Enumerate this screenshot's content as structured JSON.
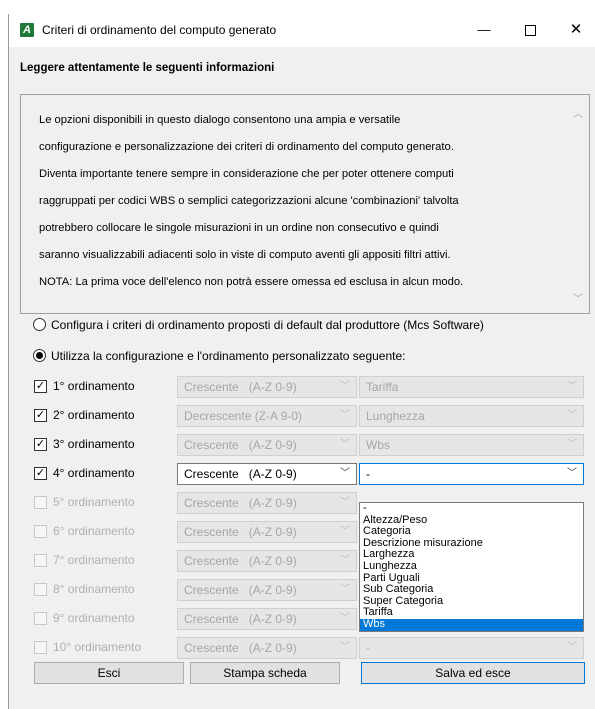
{
  "window": {
    "title": "Criteri di ordinamento del computo generato",
    "icon_letter": "A",
    "minimize": "—",
    "close": "✕"
  },
  "info": {
    "heading": "Leggere attentamente le seguenti informazioni",
    "lines": [
      "Le opzioni disponibili in questo dialogo consentono una ampia e versatile",
      "configurazione e personalizzazione dei criteri di ordinamento del computo generato.",
      "Diventa importante tenere sempre in considerazione che per poter ottenere computi",
      "raggruppati per codici WBS o semplici categorizzazioni alcune 'combinazioni' talvolta",
      "potrebbero collocare le singole misurazioni in un ordine non consecutivo e quindi",
      "saranno visualizzabili adiacenti solo in viste di computo aventi gli appositi filtri attivi.",
      "NOTA: La prima voce dell'elenco non potrà essere omessa ed esclusa in alcun modo."
    ]
  },
  "options": {
    "default_label": "Configura i criteri di ordinamento proposti di default dal produttore (Mcs Software)",
    "custom_label": "Utilizza la configurazione e l'ordinamento personalizzato seguente:",
    "selected": "custom"
  },
  "orderings": [
    {
      "label": "1° ordinamento",
      "checked": true,
      "enabled": true,
      "order": "Crescente   (A-Z 0-9)",
      "field": "Tariffa"
    },
    {
      "label": "2° ordinamento",
      "checked": true,
      "enabled": true,
      "order": "Decrescente (Z-A 9-0)",
      "field": "Lunghezza"
    },
    {
      "label": "3° ordinamento",
      "checked": true,
      "enabled": true,
      "order": "Crescente   (A-Z 0-9)",
      "field": "Wbs"
    },
    {
      "label": "4° ordinamento",
      "checked": true,
      "enabled": true,
      "order": "Crescente   (A-Z 0-9)",
      "field": "-"
    },
    {
      "label": "5° ordinamento",
      "checked": false,
      "enabled": false,
      "order": "Crescente   (A-Z 0-9)",
      "field": ""
    },
    {
      "label": "6° ordinamento",
      "checked": false,
      "enabled": false,
      "order": "Crescente   (A-Z 0-9)",
      "field": ""
    },
    {
      "label": "7° ordinamento",
      "checked": false,
      "enabled": false,
      "order": "Crescente   (A-Z 0-9)",
      "field": ""
    },
    {
      "label": "8° ordinamento",
      "checked": false,
      "enabled": false,
      "order": "Crescente   (A-Z 0-9)",
      "field": ""
    },
    {
      "label": "9° ordinamento",
      "checked": false,
      "enabled": false,
      "order": "Crescente   (A-Z 0-9)",
      "field": ""
    },
    {
      "label": "10° ordinamento",
      "checked": false,
      "enabled": false,
      "order": "Crescente   (A-Z 0-9)",
      "field": "-"
    }
  ],
  "dropdown": {
    "items": [
      "-",
      "Altezza/Peso",
      "Categoria",
      "Descrizione misurazione",
      "Larghezza",
      "Lunghezza",
      "Parti Uguali",
      "Sub Categoria",
      "Super Categoria",
      "Tariffa",
      "Wbs"
    ],
    "highlighted": "Wbs"
  },
  "buttons": {
    "exit": "Esci",
    "print": "Stampa scheda",
    "save": "Salva ed esce"
  },
  "colors": {
    "accent": "#0078d7",
    "app_icon": "#1f7a3a"
  },
  "icons": {
    "chevron": "chevron-down-icon",
    "scroll_up": "chevron-up-icon",
    "check": "checkmark-icon"
  }
}
